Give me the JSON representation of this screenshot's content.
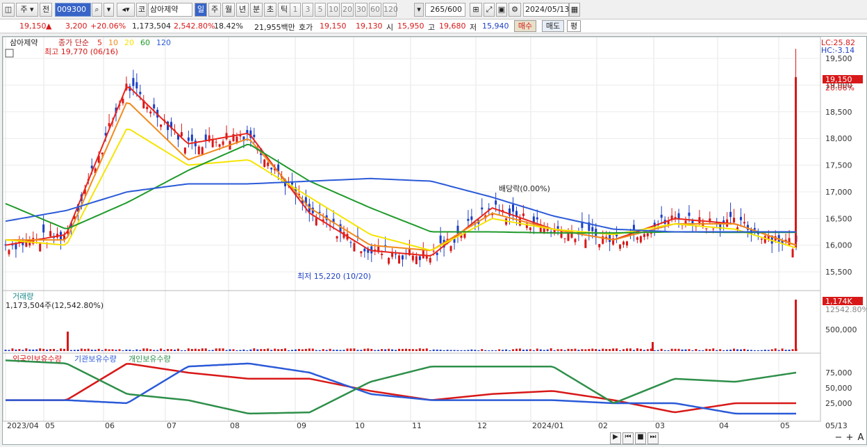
{
  "toolbar": {
    "type_label": "주",
    "prev_label": "전",
    "code": "009300",
    "exchange_label": "코",
    "name": "삼아제약",
    "periods": [
      "일",
      "주",
      "월",
      "년",
      "분",
      "초",
      "틱"
    ],
    "active_period": "일",
    "intervals": [
      "1",
      "3",
      "5",
      "10",
      "20",
      "30",
      "60",
      "120"
    ],
    "count": "265",
    "count_max": "/600",
    "date": "2024/05/13"
  },
  "info": {
    "price": "19,150",
    "arrow": "▲",
    "change": "3,200",
    "rate": "+20.06%",
    "volume": "1,173,504",
    "vol_ratio": "2,542.80%",
    "turnover": "18.42%",
    "amount": "21,955백만",
    "ask_label": "호가",
    "ask": "19,150",
    "bid": "19,130",
    "open_label": "시",
    "open": "15,950",
    "high_label": "고",
    "high": "19,680",
    "low_label": "저",
    "low": "15,940",
    "buy_label": "매수",
    "sell_label": "매도",
    "avg_label": "평"
  },
  "price_panel": {
    "title": "삼아제약",
    "ma_label": "종가 단순",
    "ma_periods": [
      "5",
      "10",
      "20",
      "60",
      "120"
    ],
    "ma_colors": [
      "#e8241b",
      "#f08a1c",
      "#f6e400",
      "#1e9a2a",
      "#2b5ad8"
    ],
    "max_label": "최고 19,770 (06/16)",
    "min_label": "최저 15,220 (10/20)",
    "div_label": "배당락(0.00%)",
    "lc": "LC:25.82",
    "hc": "HC:-3.14",
    "last_price": "19,150",
    "last_rate": "20.06%",
    "y_ticks": [
      "19,500",
      "19,000",
      "18,500",
      "18,000",
      "17,500",
      "17,000",
      "16,500",
      "16,000",
      "15,500"
    ]
  },
  "volume_panel": {
    "title": "거래량",
    "value": "1,173,504주(12,542.80%)",
    "last": "1,174K",
    "last_ratio": "12542.80%",
    "y_ticks": [
      "500,000"
    ]
  },
  "holding_panel": {
    "labels": [
      "외국인보유수량",
      "기관보유수량",
      "개인보유수량"
    ],
    "colors": [
      "#d81818",
      "#2b5ad8",
      "#2e8f4a"
    ],
    "y_ticks": [
      "75,000",
      "50,000",
      "25,000"
    ]
  },
  "x_axis": {
    "labels": [
      "2023/04",
      "05",
      "06",
      "07",
      "08",
      "09",
      "10",
      "11",
      "12",
      "2024/01",
      "02",
      "03",
      "04",
      "05"
    ],
    "last": "05/13"
  },
  "chart_data": {
    "type": "line",
    "x": [
      "2023/04",
      "05",
      "06",
      "07",
      "08",
      "09",
      "10",
      "11",
      "12",
      "2024/01",
      "02",
      "03",
      "04",
      "05"
    ],
    "ylim": [
      15200,
      19800
    ],
    "series": [
      {
        "name": "5",
        "values": [
          16000,
          16200,
          19000,
          17900,
          18100,
          16600,
          15900,
          15800,
          16700,
          16300,
          16100,
          16500,
          16400,
          16000
        ]
      },
      {
        "name": "10",
        "values": [
          16100,
          16100,
          18700,
          17600,
          18000,
          16700,
          16000,
          15900,
          16600,
          16300,
          16100,
          16400,
          16400,
          16000
        ]
      },
      {
        "name": "20",
        "values": [
          16100,
          16000,
          18200,
          17500,
          17600,
          16900,
          16200,
          15900,
          16500,
          16300,
          16200,
          16400,
          16300,
          15950
        ]
      },
      {
        "name": "60",
        "values": [
          16780,
          16300,
          16800,
          17400,
          17900,
          17200,
          16700,
          16250,
          16250,
          16230,
          16230,
          16250,
          16240,
          16240
        ]
      },
      {
        "name": "120",
        "values": [
          16450,
          16650,
          17000,
          17150,
          17150,
          17200,
          17250,
          17200,
          16900,
          16550,
          16300,
          16250,
          16250,
          16250
        ]
      },
      {
        "name": "외국인보유수량",
        "values": [
          30000,
          30000,
          90000,
          75000,
          65000,
          65000,
          45000,
          30000,
          40000,
          45000,
          30000,
          10000,
          25000,
          25000
        ]
      },
      {
        "name": "기관보유수량",
        "values": [
          30000,
          30000,
          25000,
          85000,
          90000,
          75000,
          40000,
          30000,
          30000,
          30000,
          25000,
          25000,
          8000,
          8000
        ]
      },
      {
        "name": "개인보유수량",
        "values": [
          95000,
          90000,
          40000,
          30000,
          8000,
          10000,
          60000,
          85000,
          85000,
          85000,
          25000,
          65000,
          60000,
          75000
        ]
      }
    ]
  },
  "nav": {
    "buttons": [
      "▶",
      "⏮",
      "■",
      "⏭"
    ],
    "zoom": [
      "−",
      "+",
      "A"
    ]
  }
}
